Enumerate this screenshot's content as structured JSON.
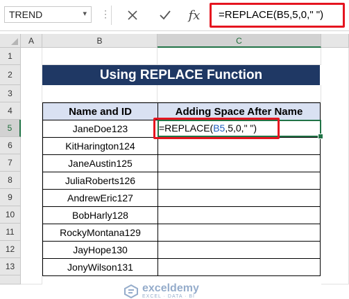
{
  "formula_bar": {
    "name_box": "TREND",
    "cancel_icon": "close-icon",
    "enter_icon": "check-icon",
    "fx_label": "fx",
    "formula": "=REPLACE(B5,5,0,\" \")"
  },
  "columns": [
    "A",
    "B",
    "C"
  ],
  "rows": [
    "1",
    "2",
    "3",
    "4",
    "5",
    "6",
    "7",
    "8",
    "9",
    "10",
    "11",
    "12",
    "13"
  ],
  "title": "Using REPLACE Function",
  "table": {
    "headers": [
      "Name and ID",
      "Adding Space After Name"
    ],
    "names": [
      "JaneDoe123",
      "KitHarington124",
      "JaneAustin125",
      "JuliaRoberts126",
      "AndrewEric127",
      "BobHarly128",
      "RockyMontana129",
      "JayHope130",
      "JonyWilson131"
    ]
  },
  "active_cell": {
    "prefix": "=REPLACE(",
    "ref": "B5",
    "suffix": ",5,0,\" \")"
  },
  "watermark": {
    "name": "exceldemy",
    "tagline": "EXCEL · DATA · BI"
  },
  "colors": {
    "title_bg": "#1f3864",
    "header_bg": "#d9e1f2",
    "highlight_red": "#e5141f",
    "excel_green": "#217346"
  }
}
